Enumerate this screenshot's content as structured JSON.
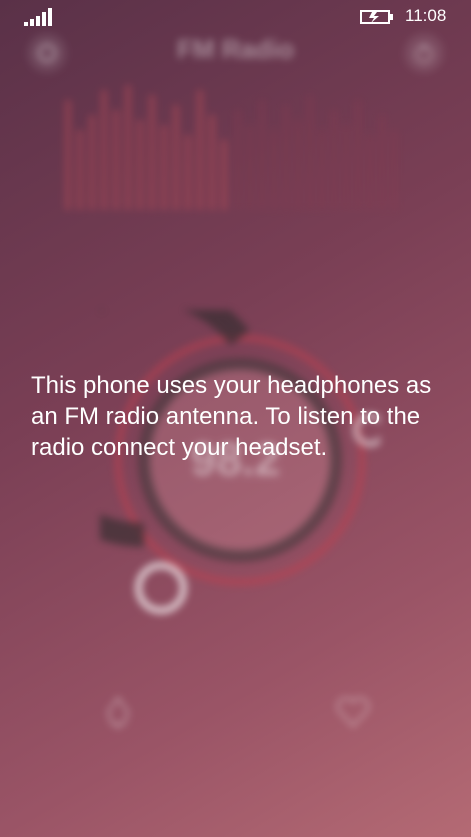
{
  "status_bar": {
    "time": "11:08",
    "signal_icon": "signal-strength-icon",
    "battery_icon": "battery-charging-icon"
  },
  "app": {
    "title": "FM Radio",
    "frequency": "98.2",
    "settings_icon": "gear-icon",
    "power_icon": "power-icon",
    "alarm_icon": "alarm-icon",
    "favorite_icon": "heart-icon"
  },
  "message": {
    "text": "This phone uses your headphones as an FM radio antenna. To listen to the radio connect your headset."
  },
  "colors": {
    "accent": "#c0404f",
    "background_start": "#5a3148",
    "background_end": "#b46a74"
  }
}
